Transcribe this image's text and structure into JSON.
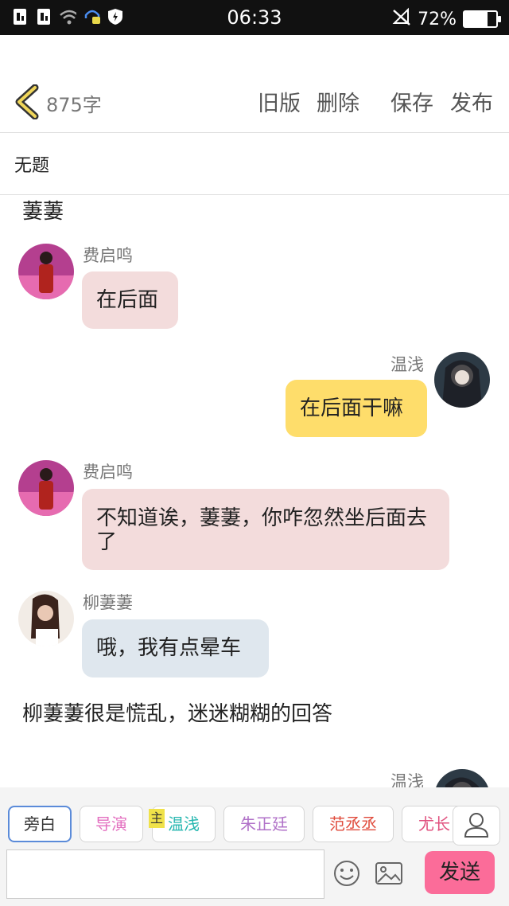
{
  "status_bar": {
    "time": "06:33",
    "battery": "72%",
    "battery_level": 0.72
  },
  "toolbar": {
    "word_count": "875字",
    "old_version": "旧版",
    "delete": "删除",
    "save": "保存",
    "publish": "发布"
  },
  "story": {
    "title": "无题"
  },
  "messages": {
    "partial_text": "萋萋",
    "m1": {
      "name": "费启鸣",
      "text": "在后面"
    },
    "m2": {
      "name": "温浅",
      "text": "在后面干嘛"
    },
    "m3": {
      "name": "费启鸣",
      "text": "不知道诶，萋萋，你咋忽然坐后面去了"
    },
    "m4": {
      "name": "柳萋萋",
      "text": "哦，我有点晕车"
    },
    "narration": "柳萋萋很是慌乱，迷迷糊糊的回答",
    "m5": {
      "name": "温浅"
    }
  },
  "roles": {
    "narrator": "旁白",
    "director": "导演",
    "lead_badge": "主",
    "wenqian": "温浅",
    "zhuzhengting": "朱正廷",
    "fanchengcheng": "范丞丞",
    "youchang": "尤长"
  },
  "input": {
    "value": "",
    "send_label": "发送"
  },
  "colors": {
    "narrator": "#333333",
    "director": "#e36fc0",
    "wenqian": "#26b7b0",
    "zhuzhengting": "#b071c8",
    "fanchengcheng": "#e04b3c",
    "youchang": "#e0507e"
  }
}
